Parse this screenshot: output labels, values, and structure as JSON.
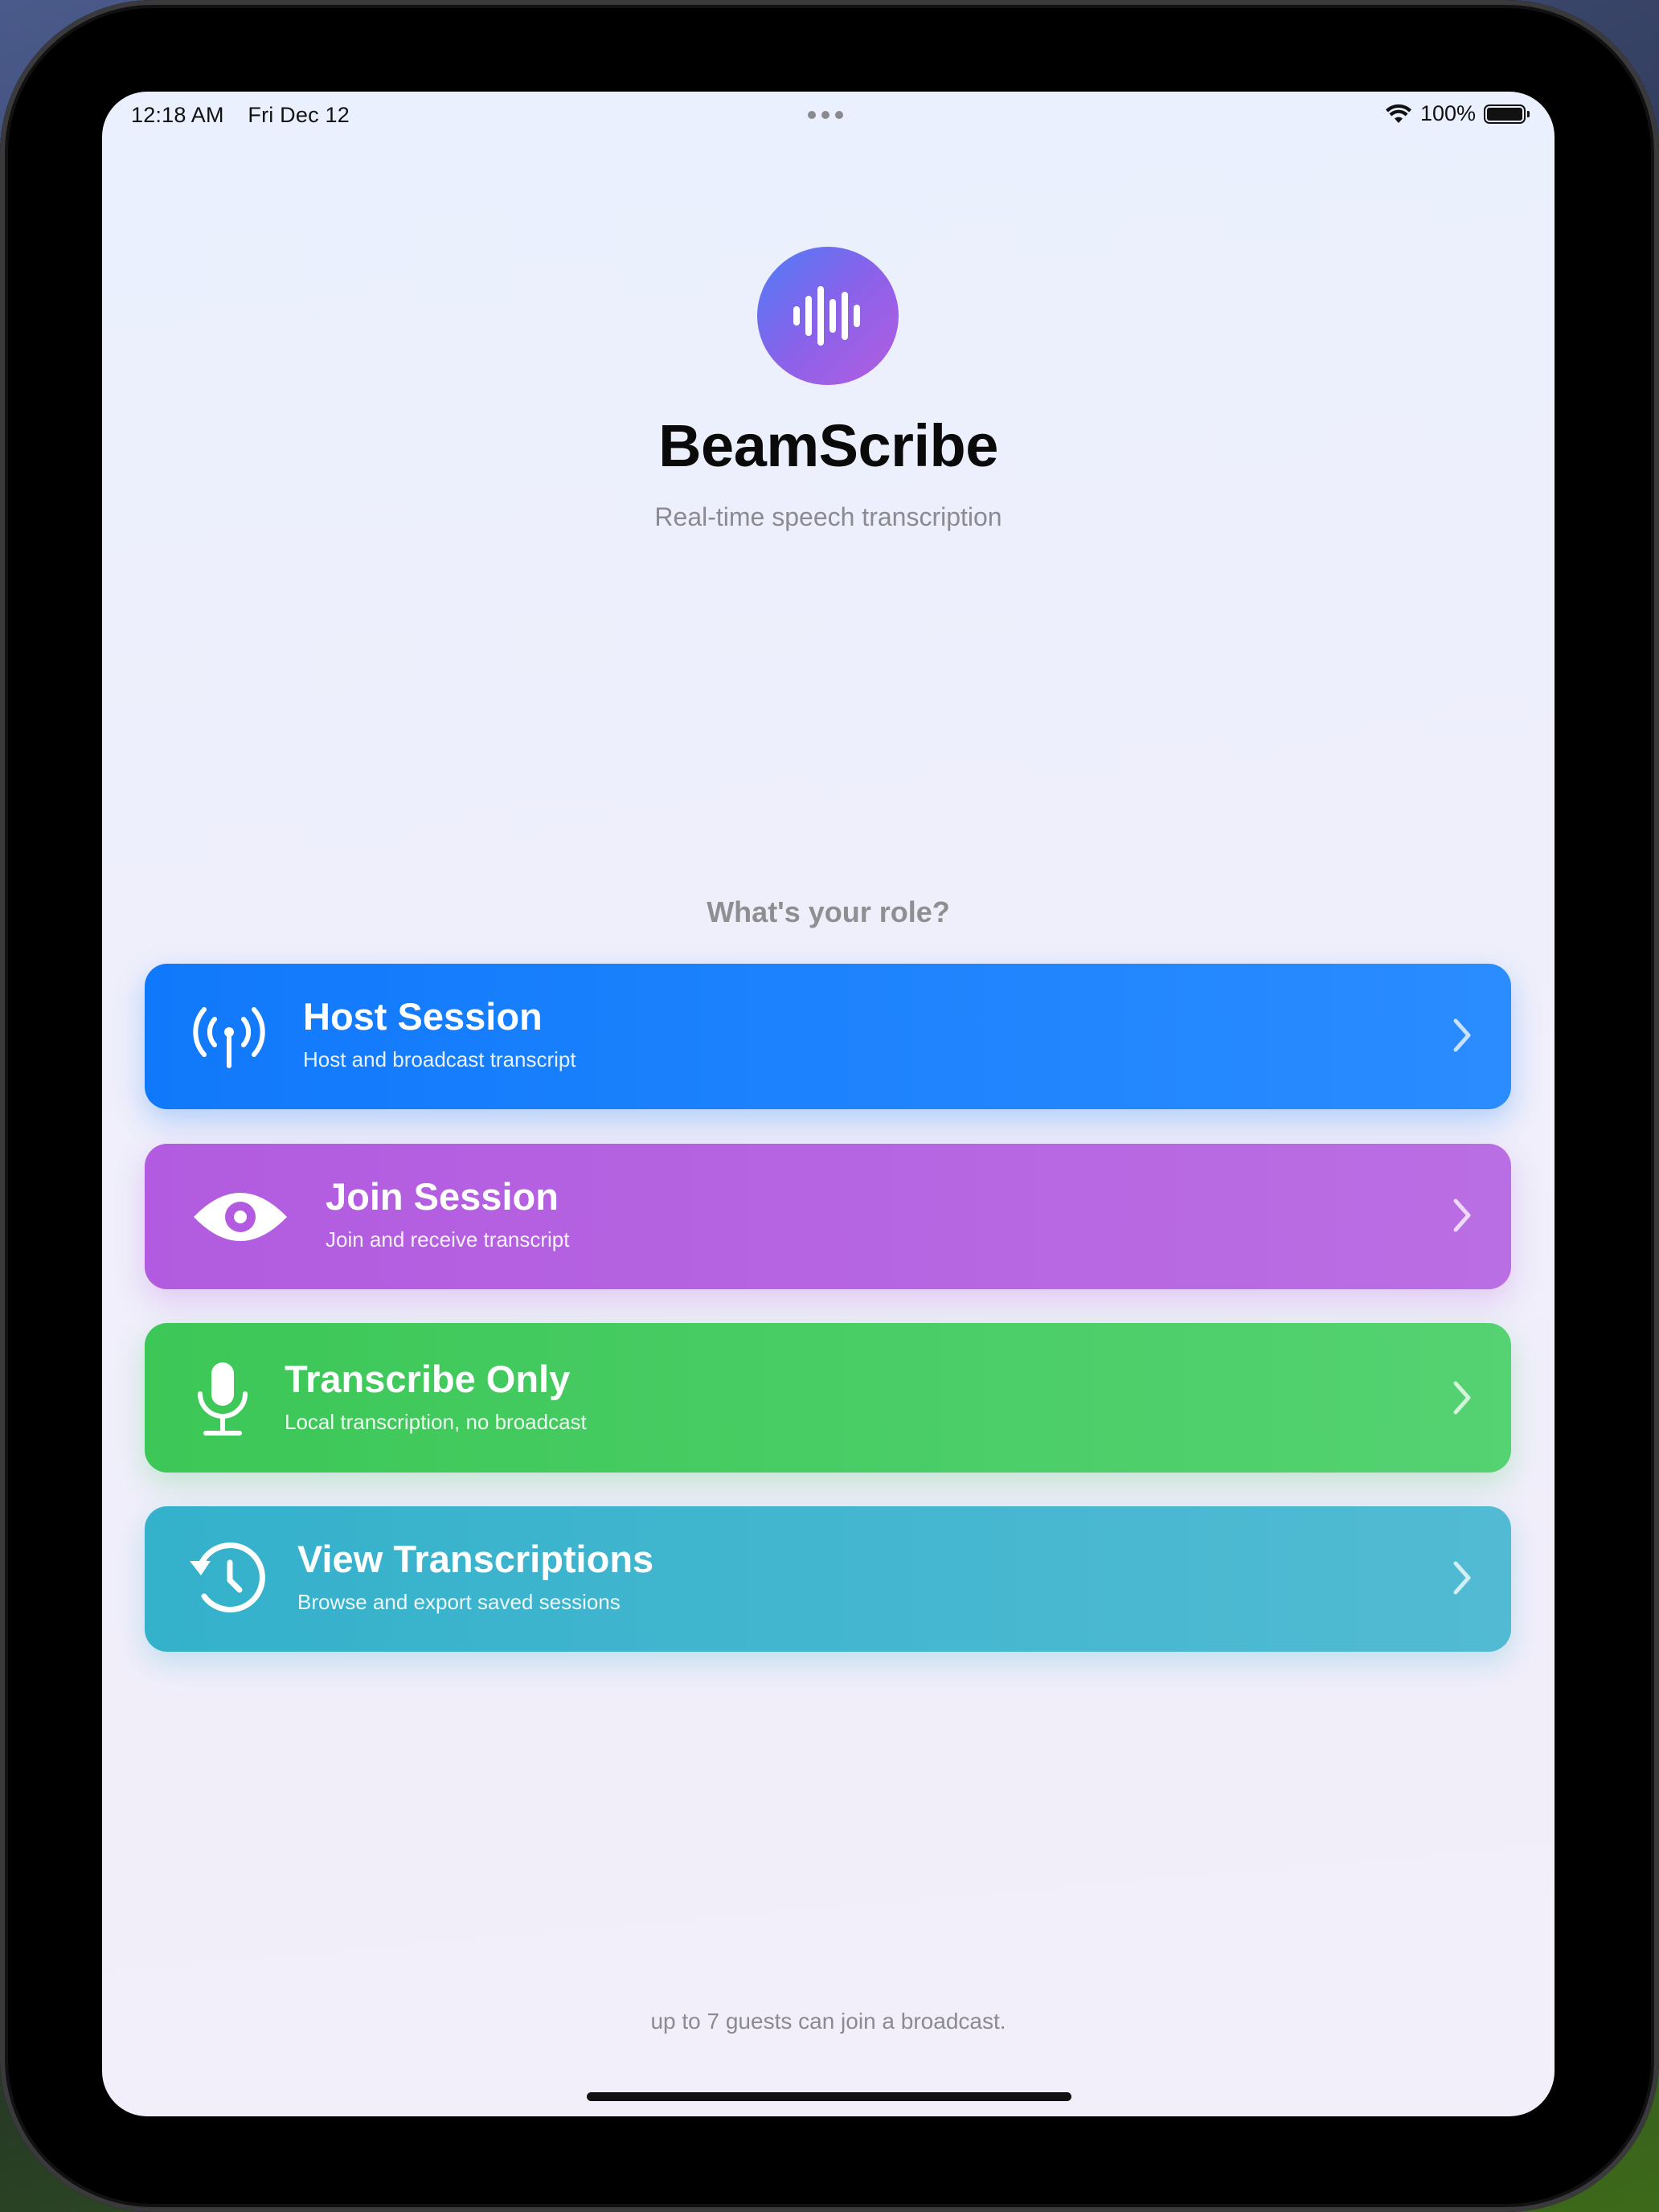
{
  "status_bar": {
    "time": "12:18 AM",
    "date": "Fri Dec 12",
    "battery_percent": "100%",
    "battery_level": 1.0
  },
  "header": {
    "logo_icon": "waveform-icon",
    "title": "BeamScribe",
    "subtitle": "Real-time speech transcription"
  },
  "role_prompt": "What's your role?",
  "options": [
    {
      "title": "Host Session",
      "subtitle": "Host and broadcast transcript",
      "icon": "antenna-broadcast-icon",
      "color": "#1079fb"
    },
    {
      "title": "Join Session",
      "subtitle": "Join and receive transcript",
      "icon": "eye-icon",
      "color": "#b25be0"
    },
    {
      "title": "Transcribe Only",
      "subtitle": "Local transcription, no broadcast",
      "icon": "microphone-icon",
      "color": "#3cc757"
    },
    {
      "title": "View Transcriptions",
      "subtitle": "Browse and export saved sessions",
      "icon": "history-clock-icon",
      "color": "#34b1cb"
    }
  ],
  "footer_note": "up to 7 guests can join a broadcast."
}
